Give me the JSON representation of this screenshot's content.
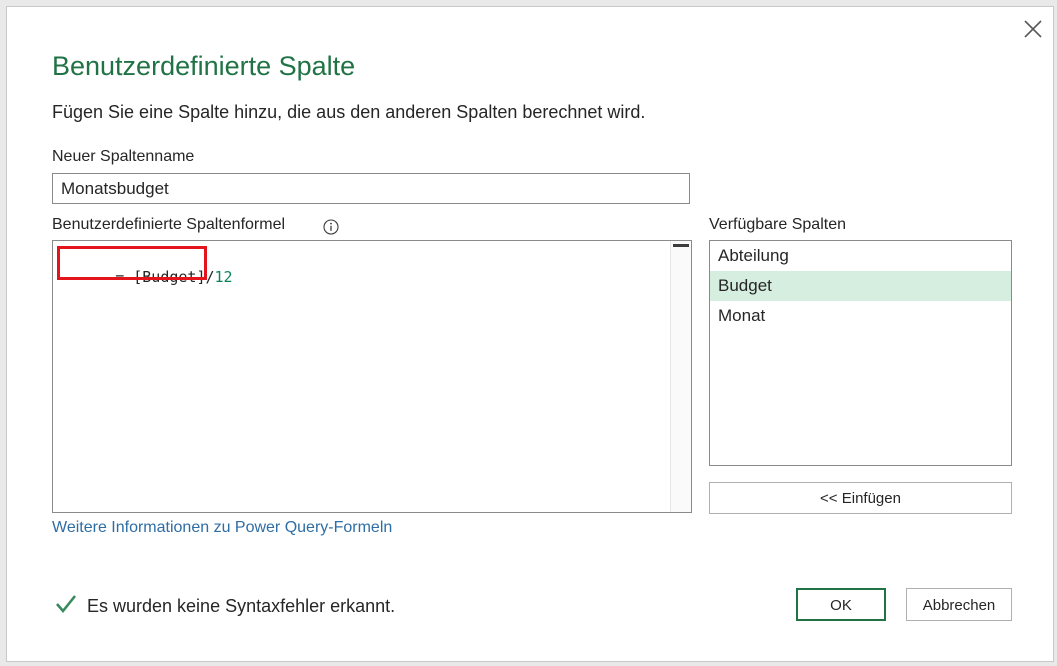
{
  "dialog": {
    "title": "Benutzerdefinierte Spalte",
    "subtitle": "Fügen Sie eine Spalte hinzu, die aus den anderen Spalten berechnet wird.",
    "close_icon": "close-icon"
  },
  "column_name": {
    "label": "Neuer Spaltenname",
    "value": "Monatsbudget"
  },
  "formula": {
    "label": "Benutzerdefinierte Spaltenformel",
    "info_icon": "info-icon",
    "prefix": "= [Budget]/",
    "number": "12",
    "highlight_color": "#e3141c"
  },
  "available_columns": {
    "label": "Verfügbare Spalten",
    "items": [
      "Abteilung",
      "Budget",
      "Monat"
    ],
    "selected": "Budget",
    "insert_label": "<< Einfügen"
  },
  "help_link": "Weitere Informationen zu Power Query-Formeln",
  "status": {
    "icon": "checkmark-icon",
    "text": "Es wurden keine Syntaxfehler erkannt."
  },
  "buttons": {
    "ok": "OK",
    "cancel": "Abbrechen"
  },
  "colors": {
    "accent": "#217346",
    "selection": "#d6eedf",
    "link": "#2e6da4"
  }
}
